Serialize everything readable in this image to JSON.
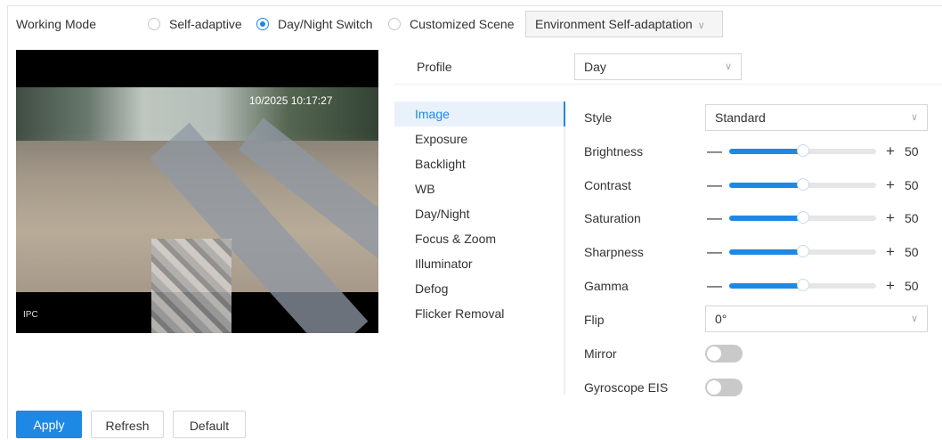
{
  "working_mode": {
    "label": "Working Mode",
    "options": [
      "Self-adaptive",
      "Day/Night Switch",
      "Customized Scene"
    ],
    "selected": "Day/Night Switch",
    "scene_select": "Environment Self-adaptation"
  },
  "preview": {
    "timestamp": "10/2025 10:17:27",
    "channel": "IPC"
  },
  "profile": {
    "label": "Profile",
    "value": "Day"
  },
  "menu": {
    "items": [
      "Image",
      "Exposure",
      "Backlight",
      "WB",
      "Day/Night",
      "Focus & Zoom",
      "Illuminator",
      "Defog",
      "Flicker Removal"
    ],
    "active": "Image"
  },
  "image_settings": {
    "style": {
      "label": "Style",
      "value": "Standard"
    },
    "sliders": [
      {
        "label": "Brightness",
        "value": 50,
        "min": 0,
        "max": 100
      },
      {
        "label": "Contrast",
        "value": 50,
        "min": 0,
        "max": 100
      },
      {
        "label": "Saturation",
        "value": 50,
        "min": 0,
        "max": 100
      },
      {
        "label": "Sharpness",
        "value": 50,
        "min": 0,
        "max": 100
      },
      {
        "label": "Gamma",
        "value": 50,
        "min": 0,
        "max": 100
      }
    ],
    "minus_symbol": "—",
    "plus_symbol": "+",
    "flip": {
      "label": "Flip",
      "value": "0°"
    },
    "mirror": {
      "label": "Mirror",
      "on": false
    },
    "gyroscope": {
      "label": "Gyroscope EIS",
      "on": false
    }
  },
  "buttons": {
    "apply": "Apply",
    "refresh": "Refresh",
    "default": "Default"
  },
  "colors": {
    "accent": "#1e88e5",
    "track": "#e6e6e6",
    "toggle_off": "#c9c9c9"
  },
  "icons": {
    "select_arrow": "chevron-down-icon"
  }
}
